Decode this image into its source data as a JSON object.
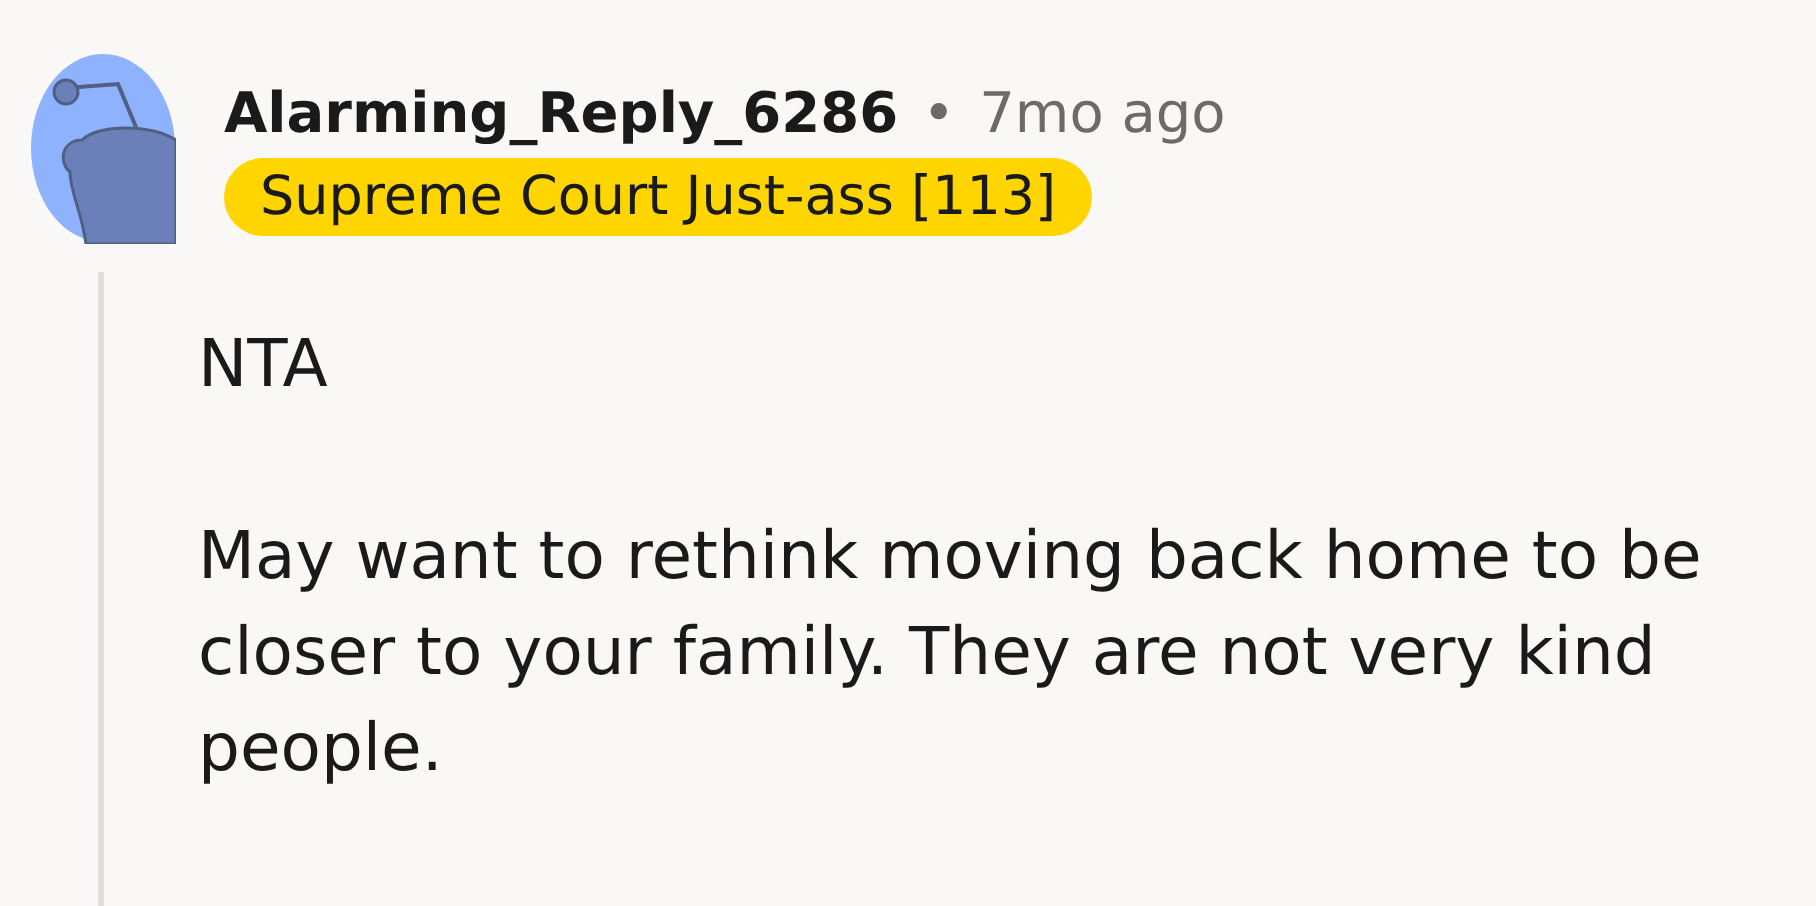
{
  "comment": {
    "author": "Alarming_Reply_6286",
    "separator": "•",
    "time": "7mo ago",
    "flair": "Supreme Court Just-ass [113]",
    "paragraphs": [
      "NTA",
      "May want to rethink moving back home to be closer to your family. They are not very kind people."
    ]
  }
}
